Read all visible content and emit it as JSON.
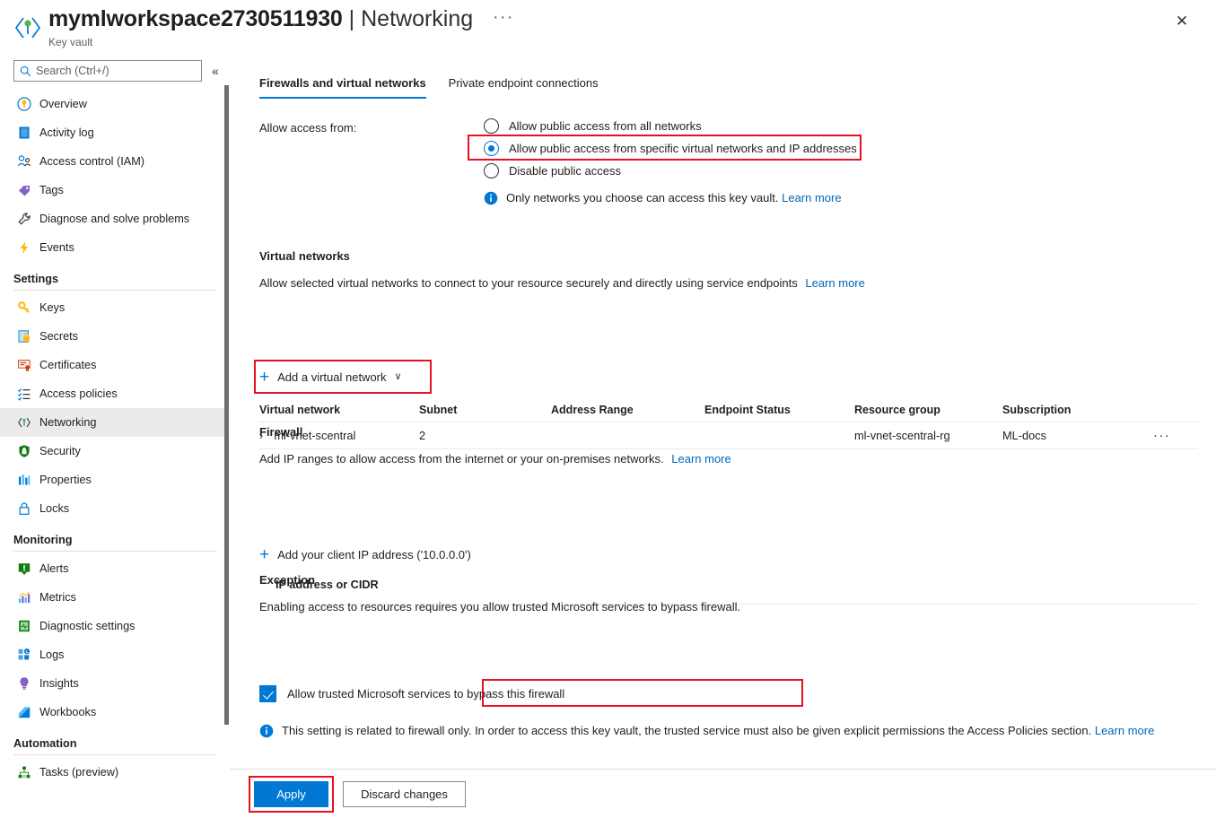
{
  "header": {
    "resource_name": "mymlworkspace2730511930",
    "separator": "|",
    "page_name": "Networking",
    "resource_type": "Key vault",
    "ellipsis": "···",
    "close_label": "✕"
  },
  "sidebar": {
    "search_placeholder": "Search (Ctrl+/)",
    "collapse_label": "«",
    "items": [
      {
        "label": "Overview",
        "icon": "key-circle-icon",
        "selected": false
      },
      {
        "label": "Activity log",
        "icon": "activity-log-icon",
        "selected": false
      },
      {
        "label": "Access control (IAM)",
        "icon": "access-control-icon",
        "selected": false
      },
      {
        "label": "Tags",
        "icon": "tags-icon",
        "selected": false
      },
      {
        "label": "Diagnose and solve problems",
        "icon": "wrench-icon",
        "selected": false
      },
      {
        "label": "Events",
        "icon": "lightning-icon",
        "selected": false
      }
    ],
    "groups": [
      {
        "title": "Settings",
        "items": [
          {
            "label": "Keys",
            "icon": "key-icon",
            "selected": false
          },
          {
            "label": "Secrets",
            "icon": "secrets-icon",
            "selected": false
          },
          {
            "label": "Certificates",
            "icon": "certificate-icon",
            "selected": false
          },
          {
            "label": "Access policies",
            "icon": "access-policies-icon",
            "selected": false
          },
          {
            "label": "Networking",
            "icon": "networking-icon",
            "selected": true
          },
          {
            "label": "Security",
            "icon": "shield-icon",
            "selected": false
          },
          {
            "label": "Properties",
            "icon": "properties-icon",
            "selected": false
          },
          {
            "label": "Locks",
            "icon": "lock-icon",
            "selected": false
          }
        ]
      },
      {
        "title": "Monitoring",
        "items": [
          {
            "label": "Alerts",
            "icon": "alerts-icon",
            "selected": false
          },
          {
            "label": "Metrics",
            "icon": "metrics-icon",
            "selected": false
          },
          {
            "label": "Diagnostic settings",
            "icon": "diagnostic-settings-icon",
            "selected": false
          },
          {
            "label": "Logs",
            "icon": "logs-icon",
            "selected": false
          },
          {
            "label": "Insights",
            "icon": "insights-icon",
            "selected": false
          },
          {
            "label": "Workbooks",
            "icon": "workbooks-icon",
            "selected": false
          }
        ]
      },
      {
        "title": "Automation",
        "items": [
          {
            "label": "Tasks (preview)",
            "icon": "tasks-icon",
            "selected": false
          }
        ]
      }
    ]
  },
  "tabs": [
    {
      "label": "Firewalls and virtual networks",
      "active": true
    },
    {
      "label": "Private endpoint connections",
      "active": false
    }
  ],
  "access": {
    "allow_access_label": "Allow access from:",
    "options": [
      {
        "label": "Allow public access from all networks",
        "selected": false,
        "highlighted": false
      },
      {
        "label": "Allow public access from specific virtual networks and IP addresses",
        "selected": true,
        "highlighted": true
      },
      {
        "label": "Disable public access",
        "selected": false,
        "highlighted": false
      }
    ],
    "info_text": "Only networks you choose can access this key vault.",
    "info_link": "Learn more"
  },
  "virtual_networks": {
    "heading": "Virtual networks",
    "description": "Allow selected virtual networks to connect to your resource securely and directly using service endpoints",
    "description_link": "Learn more",
    "add_button_label": "Add a virtual network",
    "add_button_plus": "+",
    "add_button_chevron": "∨",
    "columns": [
      "Virtual network",
      "Subnet",
      "Address Range",
      "Endpoint Status",
      "Resource group",
      "Subscription"
    ],
    "rows": [
      {
        "expand": "›",
        "virtual_network": "ml-vnet-scentral",
        "subnet": "2",
        "address_range": "",
        "endpoint_status": "",
        "resource_group": "ml-vnet-scentral-rg",
        "subscription": "ML-docs",
        "menu": "···"
      }
    ]
  },
  "firewall": {
    "heading": "Firewall",
    "description": "Add IP ranges to allow access from the internet or your on-premises networks.",
    "description_link": "Learn more",
    "add_client_ip_label": "Add your client IP address ('10.0.0.0')",
    "add_client_ip_plus": "+",
    "ip_column_header": "IP address or CIDR"
  },
  "exception": {
    "heading": "Exception",
    "description": "Enabling access to resources requires you allow trusted Microsoft services to bypass firewall.",
    "checkbox_label": "Allow trusted Microsoft services to bypass this firewall",
    "checkbox_checked": true,
    "note_text": "This setting is related to firewall only. In order to access this key vault, the trusted service must also be given explicit permissions the Access Policies section.",
    "note_link": "Learn more"
  },
  "footer": {
    "apply_label": "Apply",
    "discard_label": "Discard changes"
  },
  "colors": {
    "accent": "#0078d4",
    "link": "#0067b8",
    "highlight_box": "#e81123",
    "selected_nav_bg": "#edebe9"
  }
}
